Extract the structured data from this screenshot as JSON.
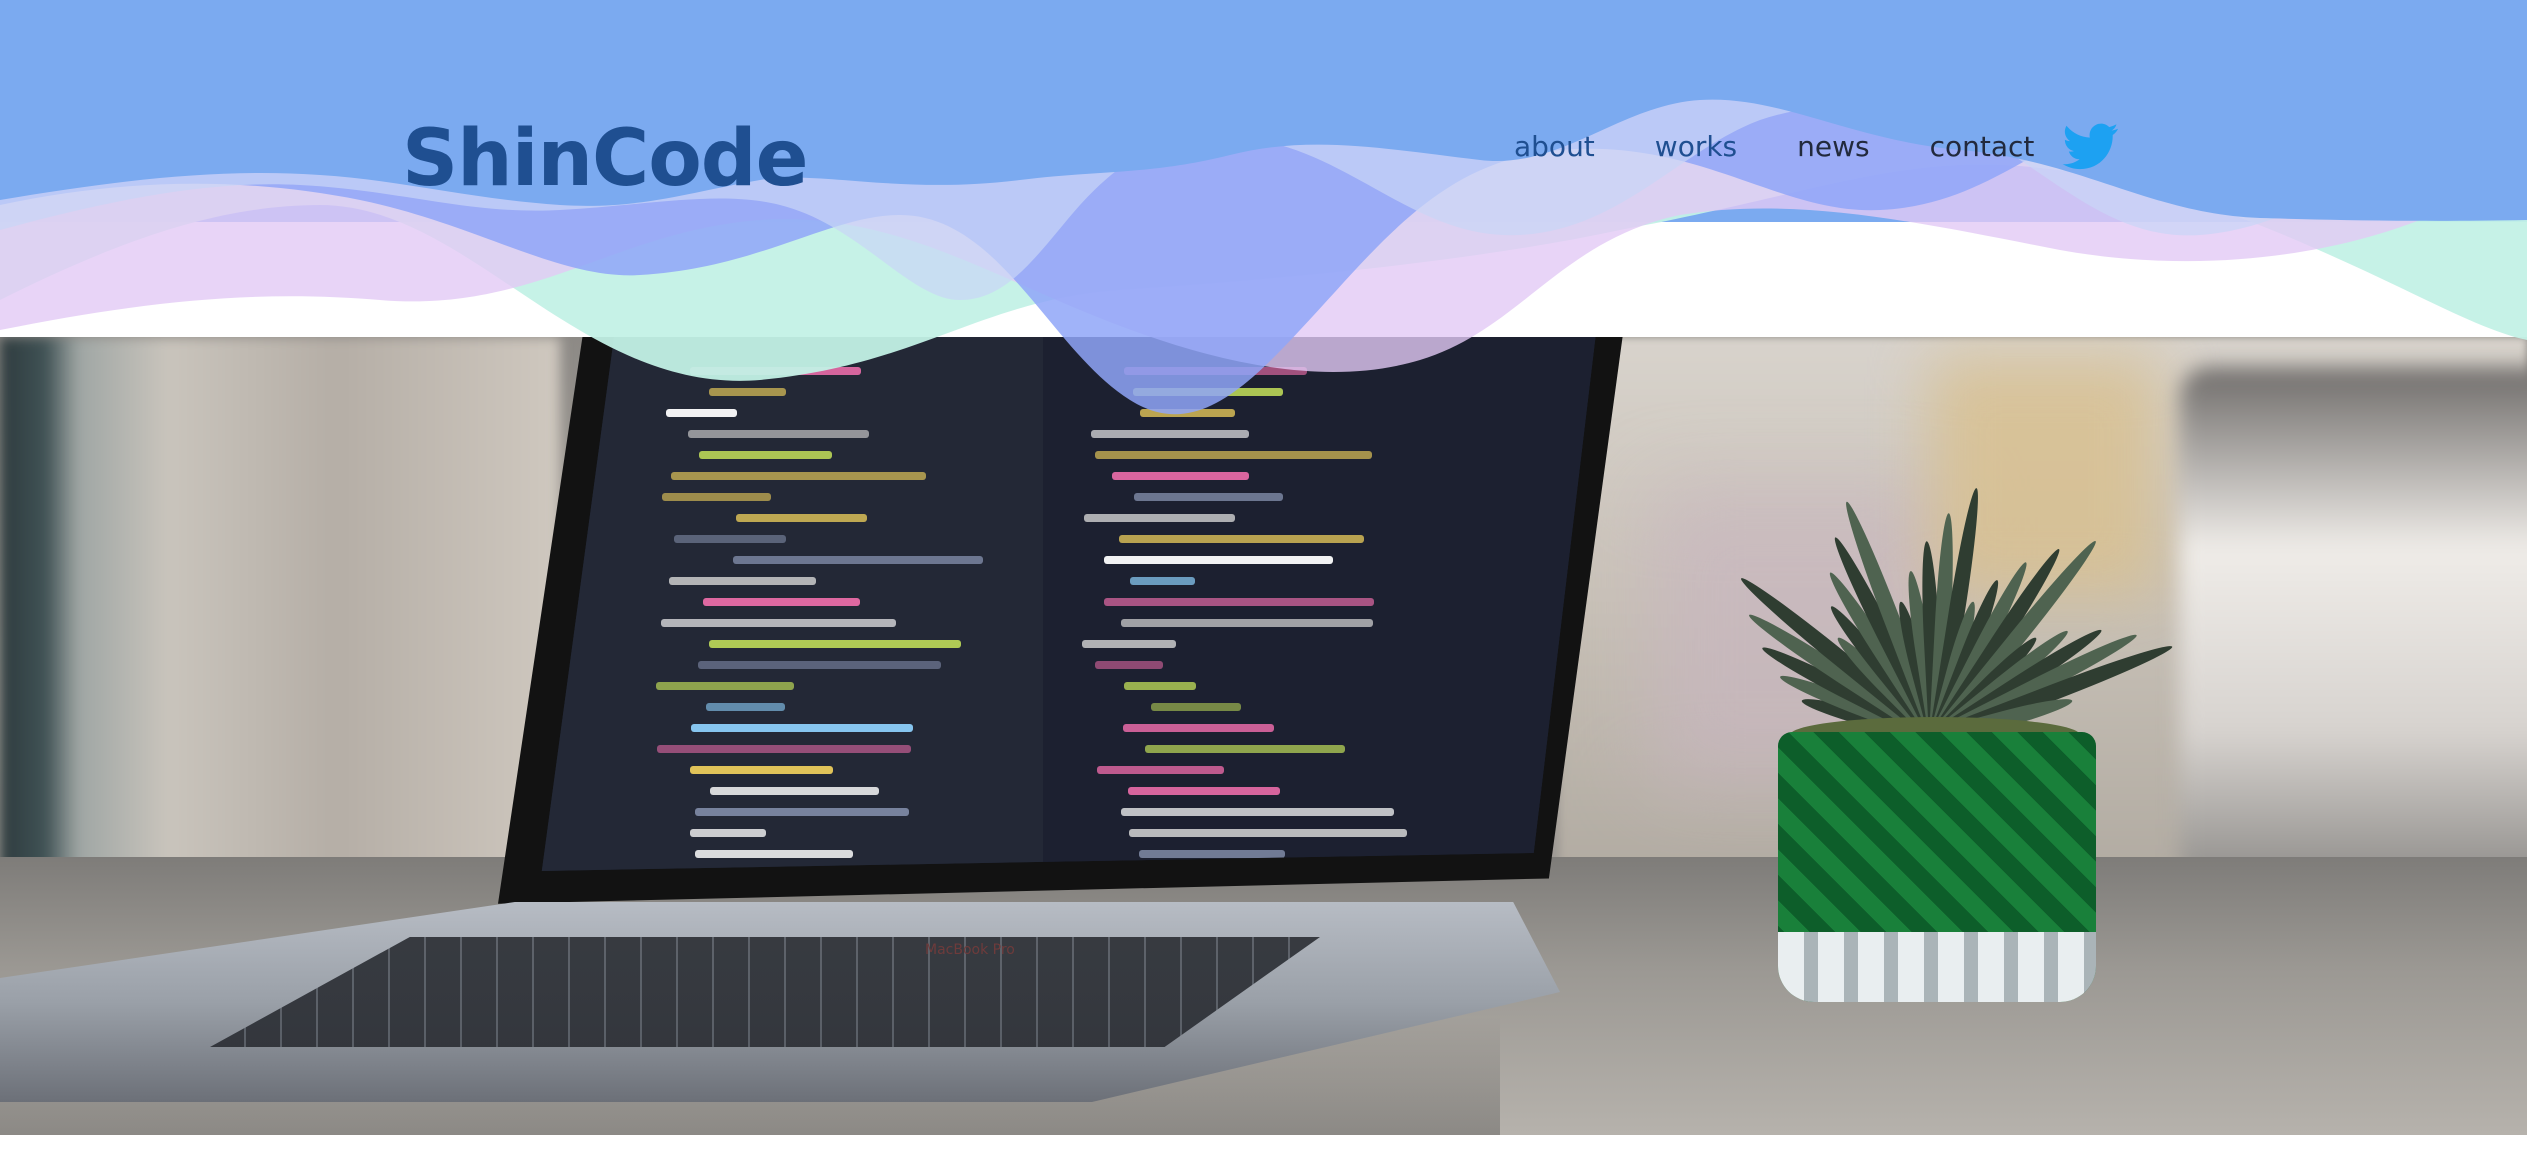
{
  "header": {
    "logo_text": "ShinCode",
    "nav_items": [
      {
        "label": "about",
        "color": "#1f4f91"
      },
      {
        "label": "works",
        "color": "#1f4f91"
      },
      {
        "label": "news",
        "color": "#222a3d"
      },
      {
        "label": "contact",
        "color": "#222a3d"
      }
    ],
    "social": {
      "icon": "twitter-icon",
      "color": "#1da1f2"
    }
  },
  "hero": {
    "image": "laptop-with-code-and-succulent-plant",
    "laptop_label": "MacBook Pro"
  },
  "colors": {
    "header_blue": "#7baaf0",
    "logo_blue": "#1f4f91",
    "wave_mint": "#c3f1e6",
    "wave_lavender": "#e2c9f5",
    "wave_periwinkle": "#8fa6f8"
  }
}
